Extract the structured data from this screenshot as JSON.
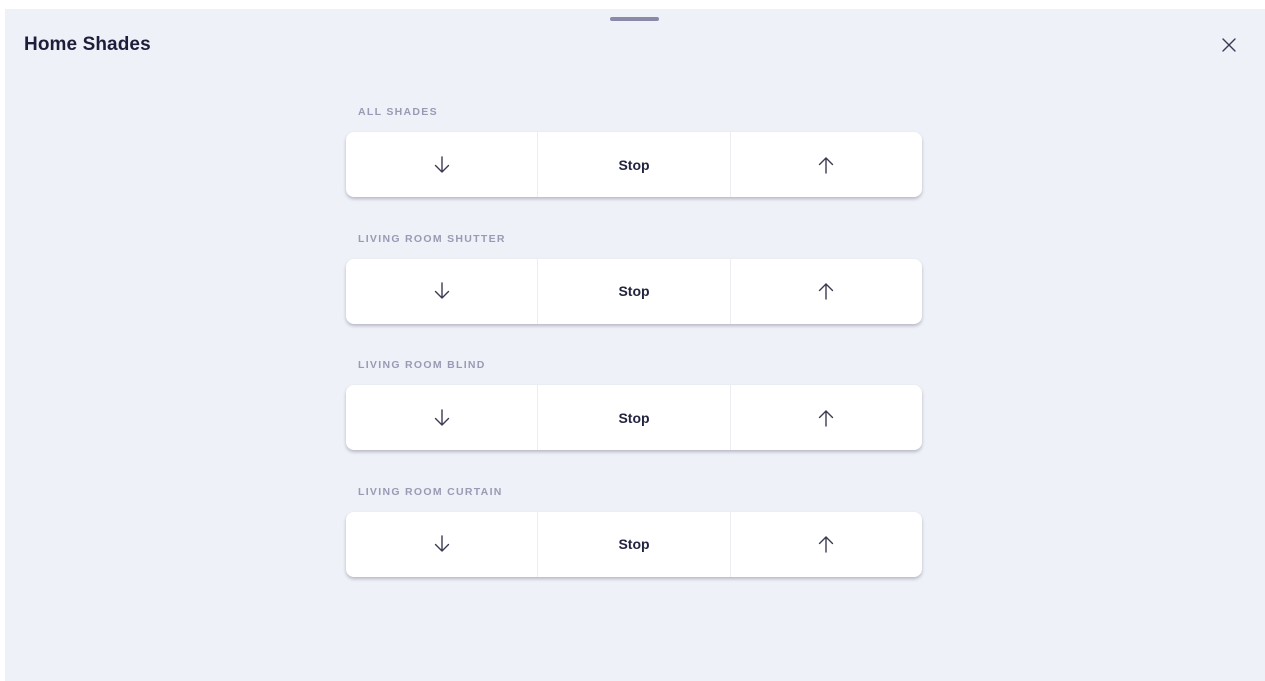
{
  "modal": {
    "title": "Home Shades",
    "close_icon": "close-icon"
  },
  "colors": {
    "background": "#eff1f8",
    "card": "#ffffff",
    "title_text": "#1d1f3a",
    "label_text": "#9a9ab4",
    "handle": "#8b89a8"
  },
  "groups": [
    {
      "label": "ALL SHADES",
      "down_icon": "arrow-down-icon",
      "stop_label": "Stop",
      "up_icon": "arrow-up-icon"
    },
    {
      "label": "LIVING ROOM SHUTTER",
      "down_icon": "arrow-down-icon",
      "stop_label": "Stop",
      "up_icon": "arrow-up-icon"
    },
    {
      "label": "LIVING ROOM BLIND",
      "down_icon": "arrow-down-icon",
      "stop_label": "Stop",
      "up_icon": "arrow-up-icon"
    },
    {
      "label": "LIVING ROOM CURTAIN",
      "down_icon": "arrow-down-icon",
      "stop_label": "Stop",
      "up_icon": "arrow-up-icon"
    }
  ]
}
